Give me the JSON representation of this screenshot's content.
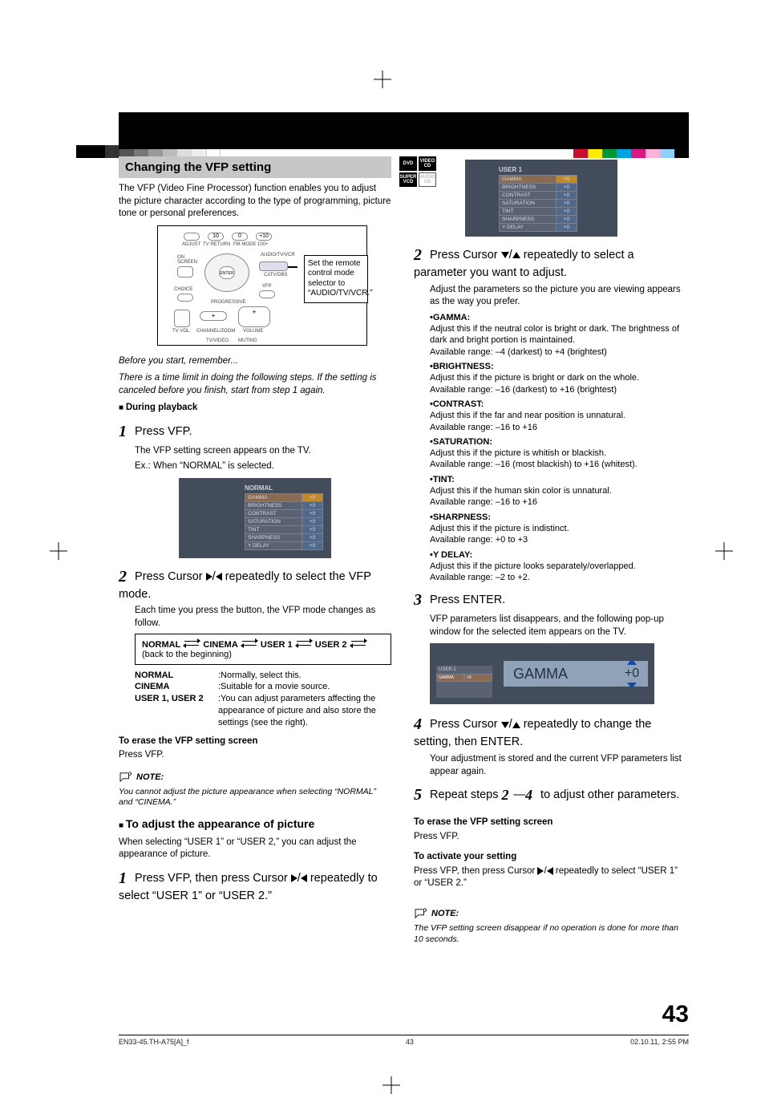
{
  "section": {
    "title": "Changing the VFP setting"
  },
  "badges": {
    "dvd": "DVD",
    "vcd": "VIDEO CD",
    "svcd": "SUPER VCD",
    "cd": "AUDIO CD"
  },
  "intro": "The VFP (Video Fine Processor) function enables you to adjust the picture character according to the type of programming, picture tone or personal preferences.",
  "remote": {
    "caption": "Set the remote control mode selector to “AUDIO/TV/VCR.”",
    "labels": {
      "adjust": "ADJUST",
      "tvreturn": "TV RETURN",
      "fmmode": "FM MODE",
      "hundred": "100+",
      "onscreen": "ON SCREEN",
      "audiotvvcr": "AUDIO/TV/VCR",
      "catvdbs": "CATV/DBS",
      "choice": "CHOICE",
      "enter": "ENTER",
      "vfp": "VFP",
      "progressive": "PROGRESSIVE",
      "tvvol": "TV VOL",
      "channel": "CHANNEL/ZOOM",
      "volume": "VOLUME",
      "tvvideo": "TV/VIDEO",
      "muting": "MUTING"
    },
    "keys": {
      "ten": "10",
      "zero": "0",
      "plus10": "+10"
    }
  },
  "before": {
    "head": "Before you start, remember...",
    "body": "There is a time limit in doing the following steps. If the setting is canceled before you finish, start from step 1 again."
  },
  "playback_head": "During playback",
  "step1": {
    "head": "Press VFP.",
    "body": "The VFP setting screen appears on the TV.",
    "ex": "Ex.: When “NORMAL” is selected."
  },
  "vfp_normal": {
    "title": "NORMAL",
    "rows": [
      {
        "k": "GAMMA",
        "v": "+0"
      },
      {
        "k": "BRIGHTNESS",
        "v": "+0"
      },
      {
        "k": "CONTRAST",
        "v": "+0"
      },
      {
        "k": "SATURATION",
        "v": "+0"
      },
      {
        "k": "TINT",
        "v": "+0"
      },
      {
        "k": "SHARPNESS",
        "v": "+0"
      },
      {
        "k": "Y DELAY",
        "v": "+0"
      }
    ]
  },
  "step2": {
    "head_a": "Press Cursor ",
    "head_b": " repeatedly to select the VFP mode.",
    "body": "Each time you press the button, the VFP mode changes as follow.",
    "modes": {
      "m1": "NORMAL",
      "m2": "CINEMA",
      "m3": "USER 1",
      "m4": "USER 2",
      "back": "(back to the beginning)"
    }
  },
  "defs": {
    "r1k": "NORMAL",
    "r1v": ":Normally, select this.",
    "r2k": "CINEMA",
    "r2v": ":Suitable for a movie source.",
    "r3k": "USER 1, USER 2",
    "r3v": ":You can adjust parameters affecting the appearance of picture and also store the settings (see the right)."
  },
  "erase_left": {
    "head": "To erase the VFP setting screen",
    "body": "Press VFP."
  },
  "note1": {
    "label": "NOTE:",
    "text": "You cannot adjust the picture appearance when selecting “NORMAL” and “CINEMA.”"
  },
  "adjust": {
    "head": "To adjust the appearance of picture",
    "body": "When selecting “USER 1” or “USER 2,” you can adjust the appearance of picture."
  },
  "r_step1": {
    "head_a": "Press VFP, then press Cursor ",
    "head_b": " repeatedly to select “USER 1” or “USER 2.”"
  },
  "vfp_user1": {
    "title": "USER 1",
    "rows": [
      {
        "k": "GAMMA",
        "v": "+0"
      },
      {
        "k": "BRIGHTNESS",
        "v": "+0"
      },
      {
        "k": "CONTRAST",
        "v": "+0"
      },
      {
        "k": "SATURATION",
        "v": "+0"
      },
      {
        "k": "TINT",
        "v": "+0"
      },
      {
        "k": "SHARPNESS",
        "v": "+0"
      },
      {
        "k": "Y DELAY",
        "v": "+0"
      }
    ]
  },
  "r_step2": {
    "head_a": "Press Cursor ",
    "head_b": " repeatedly to select a parameter you want to adjust.",
    "body": "Adjust the parameters so the picture you are viewing appears as the way you prefer."
  },
  "params": [
    {
      "name": "GAMMA:",
      "desc": "Adjust this if the neutral color is bright or dark. The brightness of dark and bright portion is maintained.",
      "range": "Available range: –4 (darkest) to +4 (brightest)"
    },
    {
      "name": "BRIGHTNESS:",
      "desc": "Adjust this if the picture is bright or dark on the whole.",
      "range": "Available range: –16 (darkest) to +16 (brightest)"
    },
    {
      "name": "CONTRAST:",
      "desc": "Adjust this if the far and near position is unnatural.",
      "range": "Available range: –16 to +16"
    },
    {
      "name": "SATURATION:",
      "desc": "Adjust this if the picture is whitish or blackish.",
      "range": "Available range:  –16 (most blackish) to +16 (whitest)."
    },
    {
      "name": "TINT:",
      "desc": "Adjust this if the human skin color is unnatural.",
      "range": "Available range:  –16 to +16"
    },
    {
      "name": "SHARPNESS:",
      "desc": "Adjust this if the picture is indistinct.",
      "range": "Available range: +0 to +3"
    },
    {
      "name": "Y DELAY:",
      "desc": "Adjust this if the picture looks separately/overlapped.",
      "range": "Available range: –2 to +2."
    }
  ],
  "r_step3": {
    "head": "Press ENTER.",
    "body": "VFP parameters list disappears, and the following pop-up window for the selected item appears on the TV."
  },
  "popup": {
    "mini_title": "USER 1",
    "mini_row_k": "GAMMA",
    "mini_row_v": "+0",
    "label": "GAMMA",
    "value": "+0"
  },
  "r_step4": {
    "head_a": "Press Cursor ",
    "head_b": " repeatedly to change the setting, then ENTER.",
    "body": "Your adjustment is stored and the current VFP parameters list appear again."
  },
  "r_step5": {
    "head_a": "Repeat steps ",
    "s2": "2",
    "dash": "—",
    "s4": "4",
    "head_b": " to adjust other parameters."
  },
  "erase_right": {
    "head": "To erase the VFP setting screen",
    "body": "Press VFP."
  },
  "activate": {
    "head": "To activate your setting",
    "body_a": "Press VFP, then press Cursor ",
    "body_b": " repeatedly to select “USER 1” or “USER 2.”"
  },
  "note2": {
    "label": "NOTE:",
    "text": "The VFP setting screen disappear if no operation is done for more than 10 seconds."
  },
  "page_number": "43",
  "footer": {
    "left": "EN33-45.TH-A75[A]_f",
    "mid": "43",
    "right": "02.10.11, 2:55 PM"
  }
}
